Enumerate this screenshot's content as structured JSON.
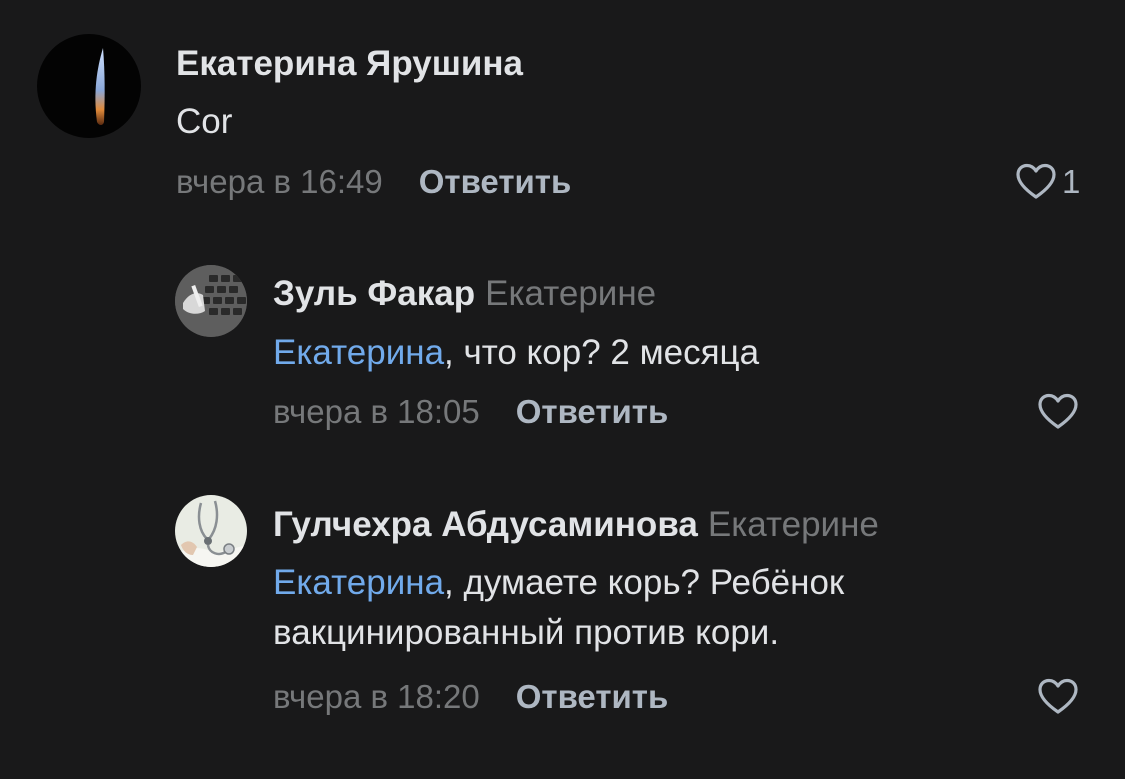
{
  "comments": [
    {
      "author": "Екатерина Ярушина",
      "text": "Cor",
      "time": "вчера в 16:49",
      "reply_label": "Ответить",
      "likes": "1"
    },
    {
      "author": "Зуль Факар",
      "reply_to": "Екатерине",
      "mention": "Екатерина",
      "text": ", что кор? 2 месяца",
      "time": "вчера в 18:05",
      "reply_label": "Ответить"
    },
    {
      "author": "Гулчехра Абдусаминова",
      "reply_to": "Екатерине",
      "mention": "Екатерина",
      "text_line1": ", думаете корь? Ребёнок",
      "text_line2": "вакцинированный против кори.",
      "time": "вчера в 18:20",
      "reply_label": "Ответить"
    }
  ],
  "colors": {
    "background": "#19191a",
    "mention": "#71aaeb",
    "secondary_text": "#76787a",
    "primary_text": "#e1e3e6"
  },
  "icons": [
    "heart-outline-icon"
  ]
}
